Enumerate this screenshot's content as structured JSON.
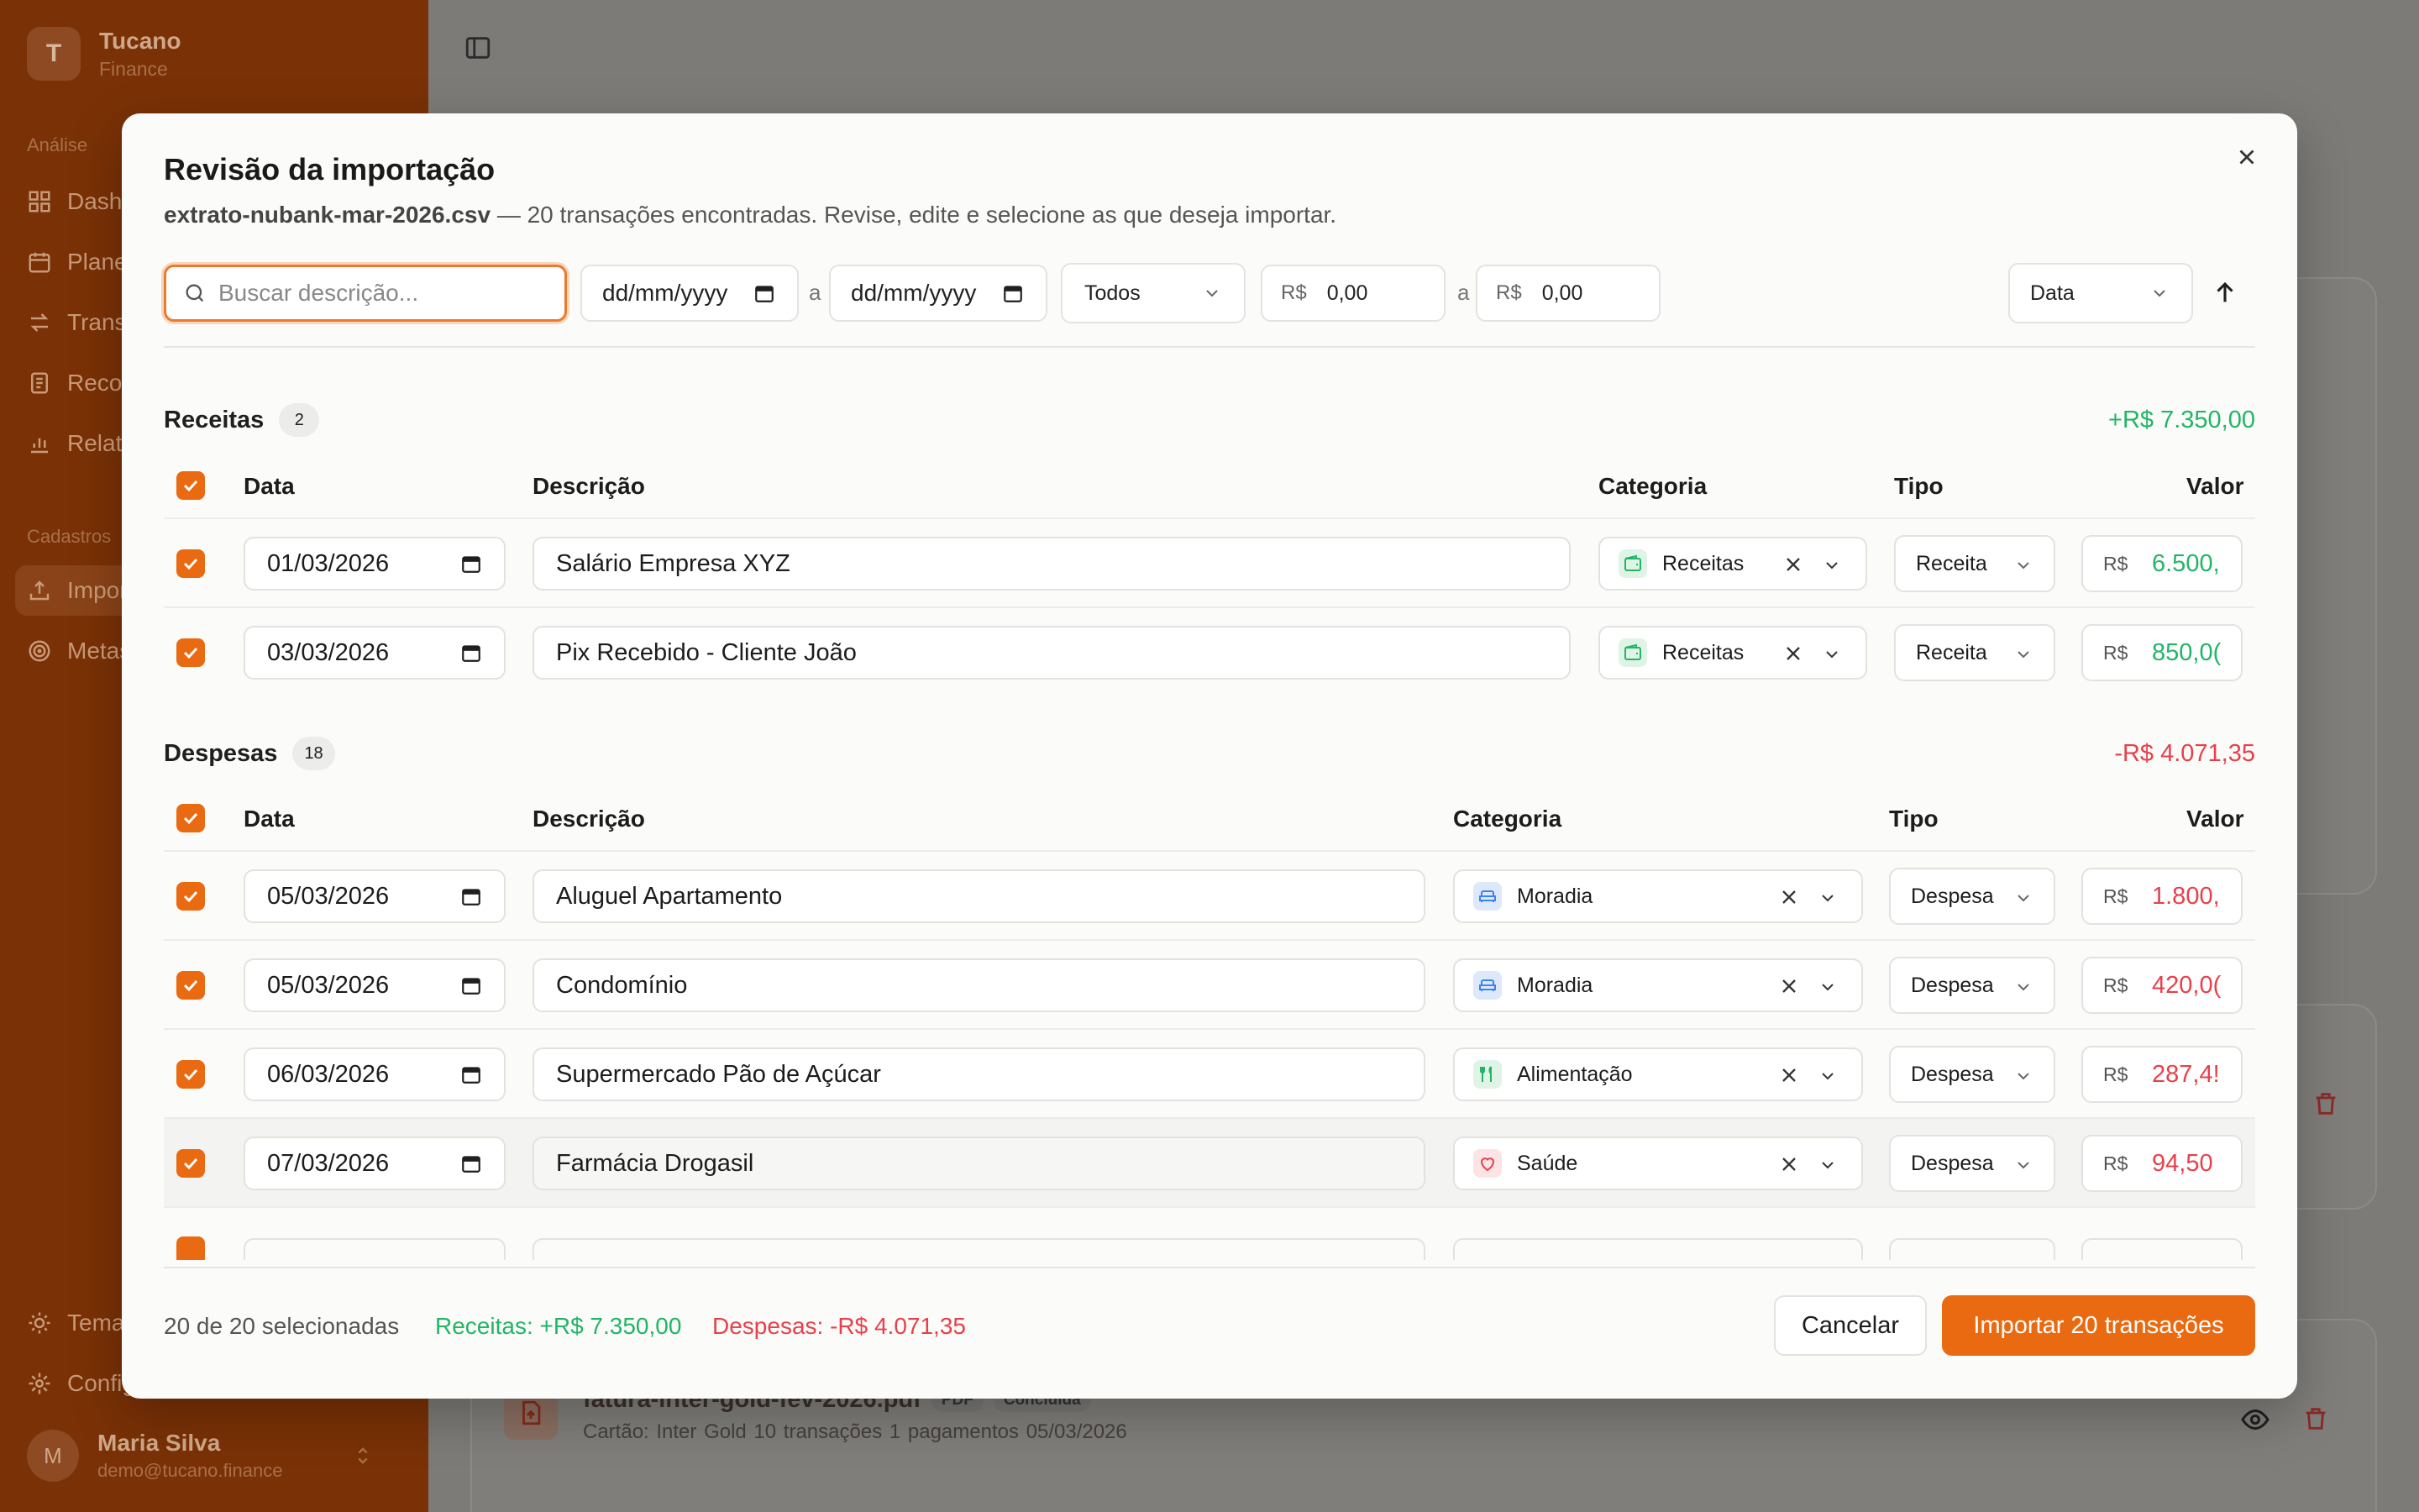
{
  "sidebar": {
    "brand": {
      "initial": "T",
      "name": "Tucano",
      "sub": "Finance"
    },
    "section_analise": "Análise",
    "items_analise": [
      "Dashboard",
      "Planejamento",
      "Transações",
      "Recorrentes",
      "Relatórios"
    ],
    "section_cadastros": "Cadastros",
    "items_cadastros": [
      "Importar",
      "Metas"
    ],
    "bottom_items": [
      "Tema",
      "Configurações"
    ],
    "user": {
      "initial": "M",
      "name": "Maria Silva",
      "email": "demo@tucano.finance"
    }
  },
  "background": {
    "file": {
      "name": "fatura-inter-gold-fev-2026.pdf",
      "type_tag": "PDF",
      "status_tag": "Concluída",
      "meta": "Cartão: Inter Gold   10 transações   1 pagamentos   05/03/2026"
    }
  },
  "modal": {
    "title": "Revisão da importação",
    "filename": "extrato-nubank-mar-2026.csv",
    "subtitle": " — 20 transações encontradas. Revise, edite e selecione as que deseja importar.",
    "filters": {
      "search_placeholder": "Buscar descrição...",
      "date_from": "dd/mm/yyyy",
      "date_sep": "a",
      "date_to": "dd/mm/yyyy",
      "type": "Todos",
      "currency": "R$",
      "min_value": "0,00",
      "value_sep": "a",
      "max_value": "0,00",
      "sort_by": "Data"
    },
    "receitas": {
      "title": "Receitas",
      "count": "2",
      "total": "+R$ 7.350,00",
      "headers": {
        "date": "Data",
        "desc": "Descrição",
        "cat": "Categoria",
        "type": "Tipo",
        "value": "Valor"
      },
      "rows": [
        {
          "date": "01/03/2026",
          "desc": "Salário Empresa XYZ",
          "cat": "Receitas",
          "type": "Receita",
          "value": "6.500,"
        },
        {
          "date": "03/03/2026",
          "desc": "Pix Recebido - Cliente João",
          "cat": "Receitas",
          "type": "Receita",
          "value": "850,0("
        }
      ]
    },
    "despesas": {
      "title": "Despesas",
      "count": "18",
      "total": "-R$ 4.071,35",
      "headers": {
        "date": "Data",
        "desc": "Descrição",
        "cat": "Categoria",
        "type": "Tipo",
        "value": "Valor"
      },
      "rows": [
        {
          "date": "05/03/2026",
          "desc": "Aluguel Apartamento",
          "cat": "Moradia",
          "type": "Despesa",
          "value": "1.800,"
        },
        {
          "date": "05/03/2026",
          "desc": "Condomínio",
          "cat": "Moradia",
          "type": "Despesa",
          "value": "420,0("
        },
        {
          "date": "06/03/2026",
          "desc": "Supermercado Pão de Açúcar",
          "cat": "Alimentação",
          "type": "Despesa",
          "value": "287,4!"
        },
        {
          "date": "07/03/2026",
          "desc": "Farmácia Drogasil",
          "cat": "Saúde",
          "type": "Despesa",
          "value": "94,50"
        }
      ]
    },
    "footer": {
      "selected": "20 de 20 selecionadas",
      "receitas": "Receitas: +R$ 7.350,00",
      "despesas": "Despesas: -R$ 4.071,35",
      "cancel": "Cancelar",
      "import": "Importar 20 transações"
    }
  },
  "colors": {
    "accent": "#ea6a12",
    "income": "#22b566",
    "expense": "#e8404a",
    "sidebar": "#7a3106"
  }
}
